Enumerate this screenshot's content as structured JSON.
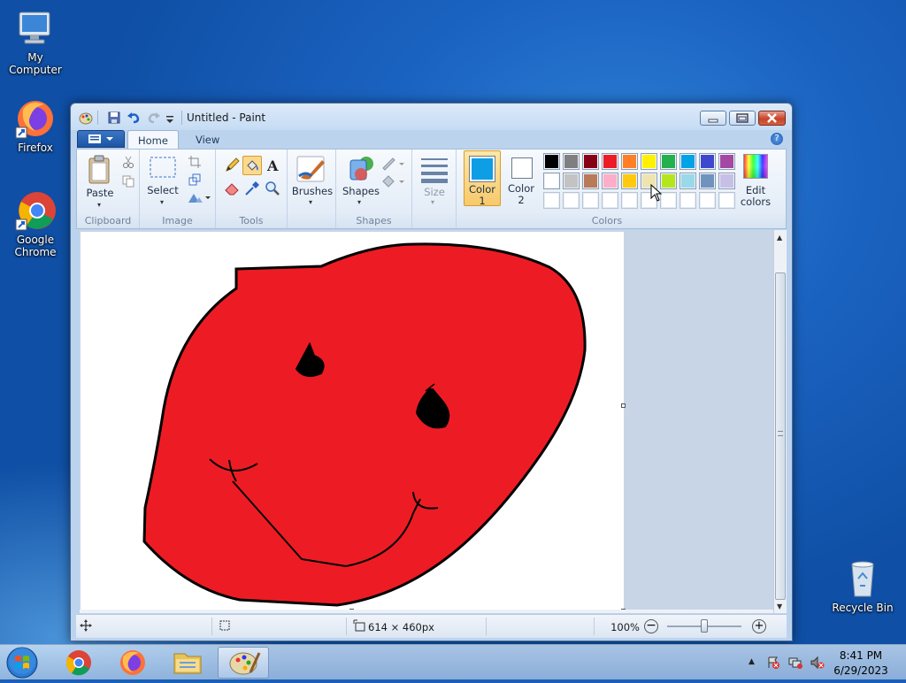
{
  "desktop": {
    "icons": [
      {
        "label": "My Computer"
      },
      {
        "label": "Firefox"
      },
      {
        "label": "Google Chrome"
      },
      {
        "label": "Recycle Bin"
      }
    ]
  },
  "window": {
    "title": "Untitled - Paint",
    "tabs": [
      {
        "label": "Home"
      },
      {
        "label": "View"
      }
    ],
    "help_icon_glyph": "?"
  },
  "ribbon": {
    "clipboard": {
      "paste_label": "Paste",
      "group_label": "Clipboard"
    },
    "image": {
      "select_label": "Select",
      "group_label": "Image"
    },
    "tools": {
      "group_label": "Tools"
    },
    "brushes": {
      "label": "Brushes"
    },
    "shapes": {
      "label": "Shapes",
      "group_label": "Shapes"
    },
    "size": {
      "label": "Size"
    },
    "colors": {
      "color1_line1": "Color",
      "color1_line2": "1",
      "color2_line1": "Color",
      "color2_line2": "2",
      "edit_line1": "Edit",
      "edit_line2": "colors",
      "group_label": "Colors",
      "color1_value": "#0d9ee5",
      "color2_value": "#ffffff",
      "palette_row1": [
        "#000000",
        "#7f7f7f",
        "#880015",
        "#ed1c24",
        "#ff7f27",
        "#fff200",
        "#22b14c",
        "#00a2e8",
        "#3f48cc",
        "#a349a4"
      ],
      "palette_row2": [
        "#ffffff",
        "#c3c3c3",
        "#b97a57",
        "#ffaec9",
        "#ffc90e",
        "#efe4b0",
        "#b5e61d",
        "#99d9ea",
        "#7092be",
        "#c8bfe7"
      ],
      "palette_row3": [
        "#ffffff",
        "#ffffff",
        "#ffffff",
        "#ffffff",
        "#ffffff",
        "#ffffff",
        "#ffffff",
        "#ffffff",
        "#ffffff",
        "#ffffff"
      ]
    }
  },
  "status": {
    "canvas_size": "614 × 460px",
    "zoom": "100%"
  },
  "taskbar": {
    "time": "8:41 PM",
    "date": "6/29/2023"
  },
  "drawing": {
    "fill_color": "#ed1c24",
    "stroke_color": "#000000"
  }
}
